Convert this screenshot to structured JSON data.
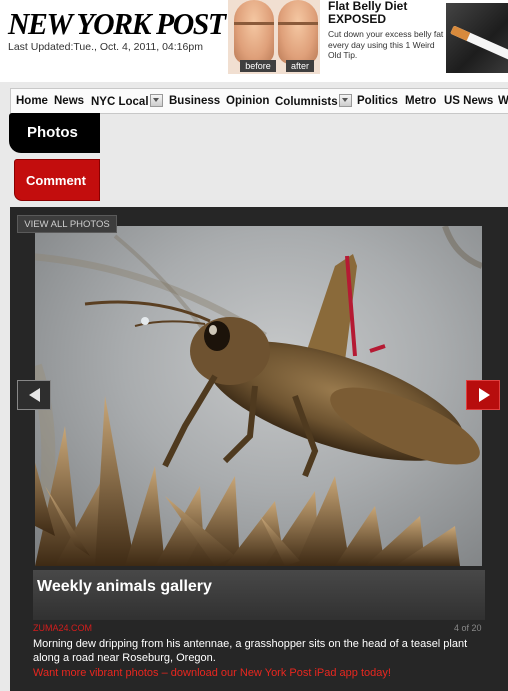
{
  "header": {
    "logo": "NEW YORK POST",
    "last_updated": "Last Updated:Tue., Oct. 4, 2011, 04:16pm"
  },
  "ad": {
    "before_label": "before",
    "after_label": "after",
    "title": "Flat Belly Diet EXPOSED",
    "text": "Cut down your excess belly fat every day using this 1 Weird Old Tip."
  },
  "nav": {
    "items": [
      "Home",
      "News",
      "NYC Local",
      "Business",
      "Opinion",
      "Columnists",
      "Politics",
      "Metro",
      "US News",
      "W"
    ]
  },
  "tabs": {
    "photos": "Photos",
    "comment": "Comment"
  },
  "gallery": {
    "view_all": "VIEW ALL PHOTOS",
    "title": "Weekly animals gallery",
    "credit": "ZUMA24.COM",
    "counter": "4 of 20",
    "caption": "Morning dew dripping from his antennae, a grasshopper sits on the head of a teasel plant along a road near Roseburg, Oregon.",
    "promo": "Want more vibrant photos – download our New York Post iPad app today!"
  },
  "colors": {
    "brand_red": "#c30d0d",
    "gallery_bg": "#262626"
  }
}
